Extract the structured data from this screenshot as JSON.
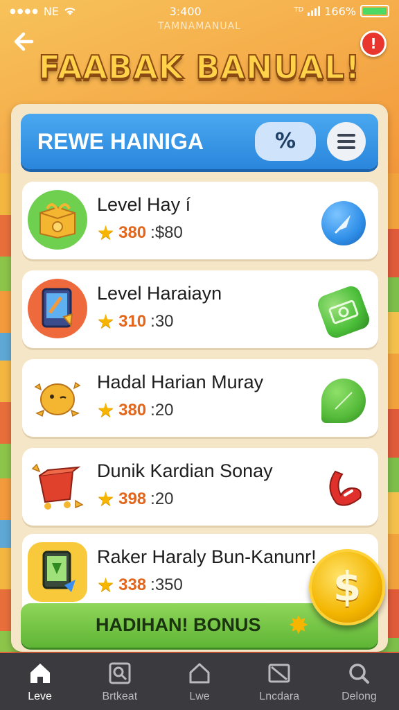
{
  "status_bar": {
    "carrier": "NE",
    "time": "3:400",
    "battery_percent": "166%",
    "battery_level": 1.0,
    "misc": "ᵀᴰ"
  },
  "header": {
    "subtitle": "TAMNAMANUAL",
    "title": "FAABAK BANUAL!",
    "alert_badge": "!"
  },
  "panel_header": {
    "title": "REWE HAINIGA",
    "percent_label": "%"
  },
  "items": [
    {
      "title": "Level Hay í",
      "points": "380",
      "reward": ":$80",
      "icon": "treasure-box-icon",
      "action_icon": "rocket-icon",
      "colors": {
        "icon_bg": "#6fcf4f",
        "action_bg": "#2f8fe8"
      }
    },
    {
      "title": "Level Haraiayn",
      "points": "310",
      "reward": ":30",
      "icon": "tablet-game-icon",
      "action_icon": "cash-icon",
      "colors": {
        "icon_bg": "#ee6a3c",
        "action_bg": "#4cbf3a"
      }
    },
    {
      "title": "Hadal Harian Muray",
      "points": "380",
      "reward": ":20",
      "icon": "chick-character-icon",
      "action_icon": "leaf-icon",
      "colors": {
        "icon_bg": "#ffffff",
        "action_bg": "#56bb3a"
      }
    },
    {
      "title": "Dunik Kardian Sonay",
      "points": "398",
      "reward": ":20",
      "icon": "gift-cart-icon",
      "action_icon": "red-ribbon-icon",
      "colors": {
        "icon_bg": "#ffffff",
        "action_bg": "#e0302c"
      }
    },
    {
      "title": "Raker Haraly Bun-Kanunr!",
      "points": "338",
      "reward": ":350",
      "icon": "phone-reward-icon",
      "action_icon": "",
      "colors": {
        "icon_bg": "#f8c93a",
        "action_bg": ""
      }
    }
  ],
  "bonus": {
    "label": "HADIHAN! BONUS",
    "coin_symbol": "$"
  },
  "nav": [
    {
      "label": "Leve",
      "icon": "home-icon",
      "active": true
    },
    {
      "label": "Brtkeat",
      "icon": "search-box-icon",
      "active": false
    },
    {
      "label": "Lwe",
      "icon": "house-outline-icon",
      "active": false
    },
    {
      "label": "Lncdara",
      "icon": "image-frame-icon",
      "active": false
    },
    {
      "label": "Delong",
      "icon": "search-icon",
      "active": false
    }
  ]
}
